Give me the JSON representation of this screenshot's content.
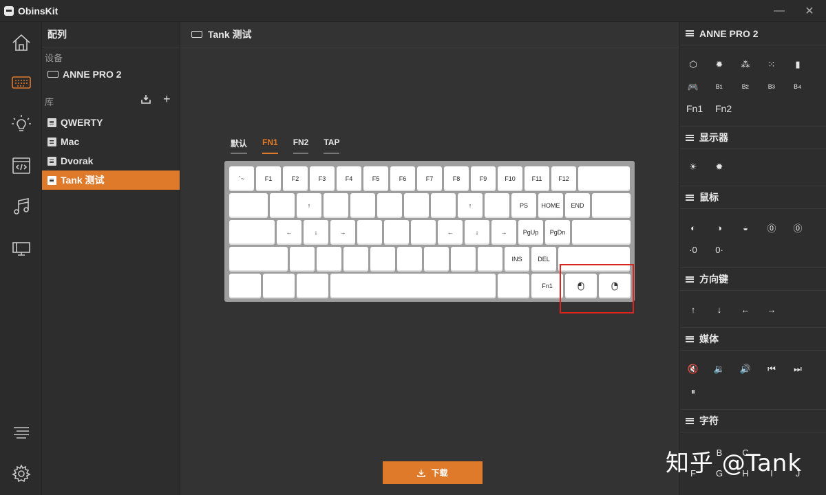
{
  "window": {
    "title": "ObinsKit",
    "minimize_glyph": "—",
    "close_glyph": "✕"
  },
  "rail": {
    "items": [
      "home-icon",
      "keyboard-icon",
      "bulb-icon",
      "code-icon",
      "music-icon",
      "monitor-icon",
      "list-icon",
      "gear-icon"
    ],
    "active": "keyboard-icon"
  },
  "left": {
    "header": "配列",
    "device_section": "设备",
    "device_name": "ANNE PRO 2",
    "library_section": "库",
    "library": [
      {
        "label": "QWERTY",
        "selected": false
      },
      {
        "label": "Mac",
        "selected": false
      },
      {
        "label": "Dvorak",
        "selected": false
      },
      {
        "label": "Tank 测试",
        "selected": true
      }
    ]
  },
  "main": {
    "header": "Tank 测试",
    "tabs": [
      {
        "label": "默认",
        "active": false
      },
      {
        "label": "FN1",
        "active": true
      },
      {
        "label": "FN2",
        "active": false
      },
      {
        "label": "TAP",
        "active": false
      }
    ],
    "keyboard_rows": [
      [
        "`~",
        "F1",
        "F2",
        "F3",
        "F4",
        "F5",
        "F6",
        "F7",
        "F8",
        "F9",
        "F10",
        "F11",
        "F12",
        ""
      ],
      [
        "",
        "",
        "↑",
        "",
        "",
        "",
        "",
        "",
        "↑",
        "",
        "PS",
        "HOME",
        "END",
        ""
      ],
      [
        "",
        "←",
        "↓",
        "→",
        "",
        "",
        "",
        "←",
        "↓",
        "→",
        "PgUp",
        "PgDn",
        ""
      ],
      [
        "",
        "",
        "",
        "",
        "",
        "",
        "",
        "",
        "",
        "INS",
        "DEL",
        ""
      ],
      [
        "",
        "",
        "",
        "",
        "",
        "Fn1",
        "left-click-mouse-icon",
        "right-click-mouse-icon"
      ]
    ],
    "download_label": "下载",
    "accent": "#e07a2b",
    "highlight_color": "#d8261f"
  },
  "right": {
    "header": "ANNE PRO 2",
    "device_keys": [
      "⬡",
      "✹",
      "⁂",
      "⁙",
      "▮",
      "🎮",
      "ᴮ¹",
      "ᴮ²",
      "ᴮ³",
      "ᴮ⁴"
    ],
    "fn_keys": [
      "Fn1",
      "Fn2"
    ],
    "display_section": "显示器",
    "display_keys": [
      "☀",
      "✹"
    ],
    "mouse_section": "鼠标",
    "mouse_keys": [
      "◐",
      "◑",
      "◒",
      "⓪",
      "⓪",
      "·0",
      "0·"
    ],
    "arrow_section": "方向键",
    "arrow_keys": [
      "↑",
      "↓",
      "←",
      "→"
    ],
    "media_section": "媒体",
    "media_keys": [
      "🔇",
      "🔉",
      "🔊",
      "⏮",
      "⏭",
      "⏸"
    ],
    "char_section": "字符",
    "char_keys_row1": [
      "B",
      "C"
    ],
    "char_keys_row2": [
      "F",
      "G",
      "H",
      "I",
      "J"
    ]
  },
  "watermark": "知乎 @Tank"
}
